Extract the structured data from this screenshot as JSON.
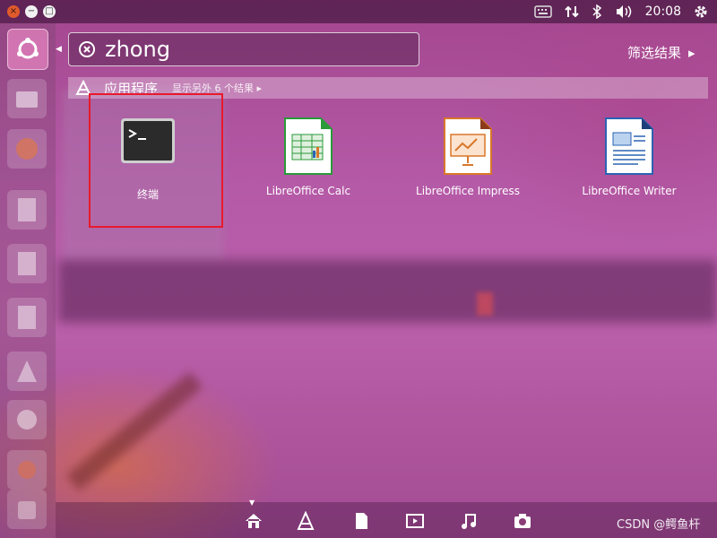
{
  "top_panel": {
    "close_glyph": "×",
    "minimize_glyph": "−",
    "maximize_glyph": "□",
    "clock": "20:08",
    "indicators": [
      "keyboard-icon",
      "network-icon",
      "bluetooth-icon",
      "volume-icon",
      "settings-icon"
    ]
  },
  "search": {
    "value": "zhong"
  },
  "filter": {
    "label": "筛选结果",
    "arrow": "▸"
  },
  "category": {
    "title": "应用程序",
    "more": "显示另外 6 个结果",
    "more_arrow": "▸"
  },
  "results": [
    {
      "label": "终端",
      "icon": "terminal-icon"
    },
    {
      "label": "LibreOffice Calc",
      "icon": "libreoffice-calc-icon"
    },
    {
      "label": "LibreOffice Impress",
      "icon": "libreoffice-impress-icon"
    },
    {
      "label": "LibreOffice Writer",
      "icon": "libreoffice-writer-icon"
    }
  ],
  "launcher": [
    "ubuntu-dash-icon",
    "files-icon",
    "firefox-icon",
    "writer-icon",
    "calc-icon",
    "impress-icon",
    "software-center-icon",
    "amazon-icon",
    "settings-icon",
    "trash-icon"
  ],
  "lenses": [
    "home-icon",
    "applications-icon",
    "files-icon",
    "video-icon",
    "music-icon",
    "photo-icon"
  ],
  "watermark": "CSDN @鳄鱼杆",
  "colors": {
    "highlight": "#e8192c",
    "calc_green": "#2a9a3a",
    "impress_orange": "#d9772a",
    "writer_blue": "#2a63b4"
  }
}
